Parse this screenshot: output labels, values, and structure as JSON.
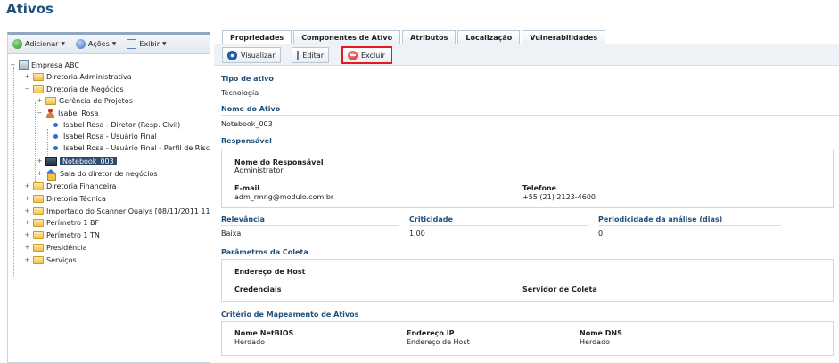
{
  "page": {
    "title": "Ativos"
  },
  "toolbar": {
    "add_label": "Adicionar",
    "actions_label": "Ações",
    "view_label": "Exibir"
  },
  "tree": {
    "root": "Empresa ABC",
    "items": [
      "Diretoria Administrativa",
      "Diretoria de Negócios",
      "Gerência de Projetos",
      "Isabel Rosa",
      "Isabel Rosa - Diretor (Resp. Civil)",
      "Isabel Rosa - Usuário Final",
      "Isabel Rosa - Usuário Final - Perfil de Risc",
      "Notebook_003",
      "Sala do diretor de negócios",
      "Diretoria Financeira",
      "Diretoria Técnica",
      "Importado do Scanner Qualys [08/11/2011 11:40",
      "Perímetro 1 BF",
      "Perímetro 1 TN",
      "Presidência",
      "Serviços"
    ]
  },
  "tabs": [
    "Propriedades",
    "Componentes de Ativo",
    "Atributos",
    "Localização",
    "Vulnerabilidades"
  ],
  "actions": {
    "view": "Visualizar",
    "edit": "Editar",
    "delete": "Excluir"
  },
  "details": {
    "tipo_label": "Tipo de ativo",
    "tipo_value": "Tecnologia",
    "nome_label": "Nome do Ativo",
    "nome_value": "Notebook_003",
    "responsavel_label": "Responsável",
    "resp_nome_label": "Nome do Responsável",
    "resp_nome_value": "Administrator",
    "email_label": "E-mail",
    "email_value": "adm_rmng@modulo.com.br",
    "telefone_label": "Telefone",
    "telefone_value": "+55 (21) 2123-4600",
    "relevancia_label": "Relevância",
    "relevancia_value": "Baixa",
    "criticidade_label": "Criticidade",
    "criticidade_value": "1,00",
    "periodicidade_label": "Periodicidade da análise (dias)",
    "periodicidade_value": "0",
    "coleta_label": "Parâmetros da Coleta",
    "host_label": "Endereço de Host",
    "credenciais_label": "Credenciais",
    "servidor_label": "Servidor de Coleta",
    "mapeamento_label": "Critério de Mapeamento de Ativos",
    "netbios_label": "Nome NetBIOS",
    "netbios_value": "Herdado",
    "ip_label": "Endereço IP",
    "ip_value": "Endereço de Host",
    "dns_label": "Nome DNS",
    "dns_value": "Herdado"
  }
}
